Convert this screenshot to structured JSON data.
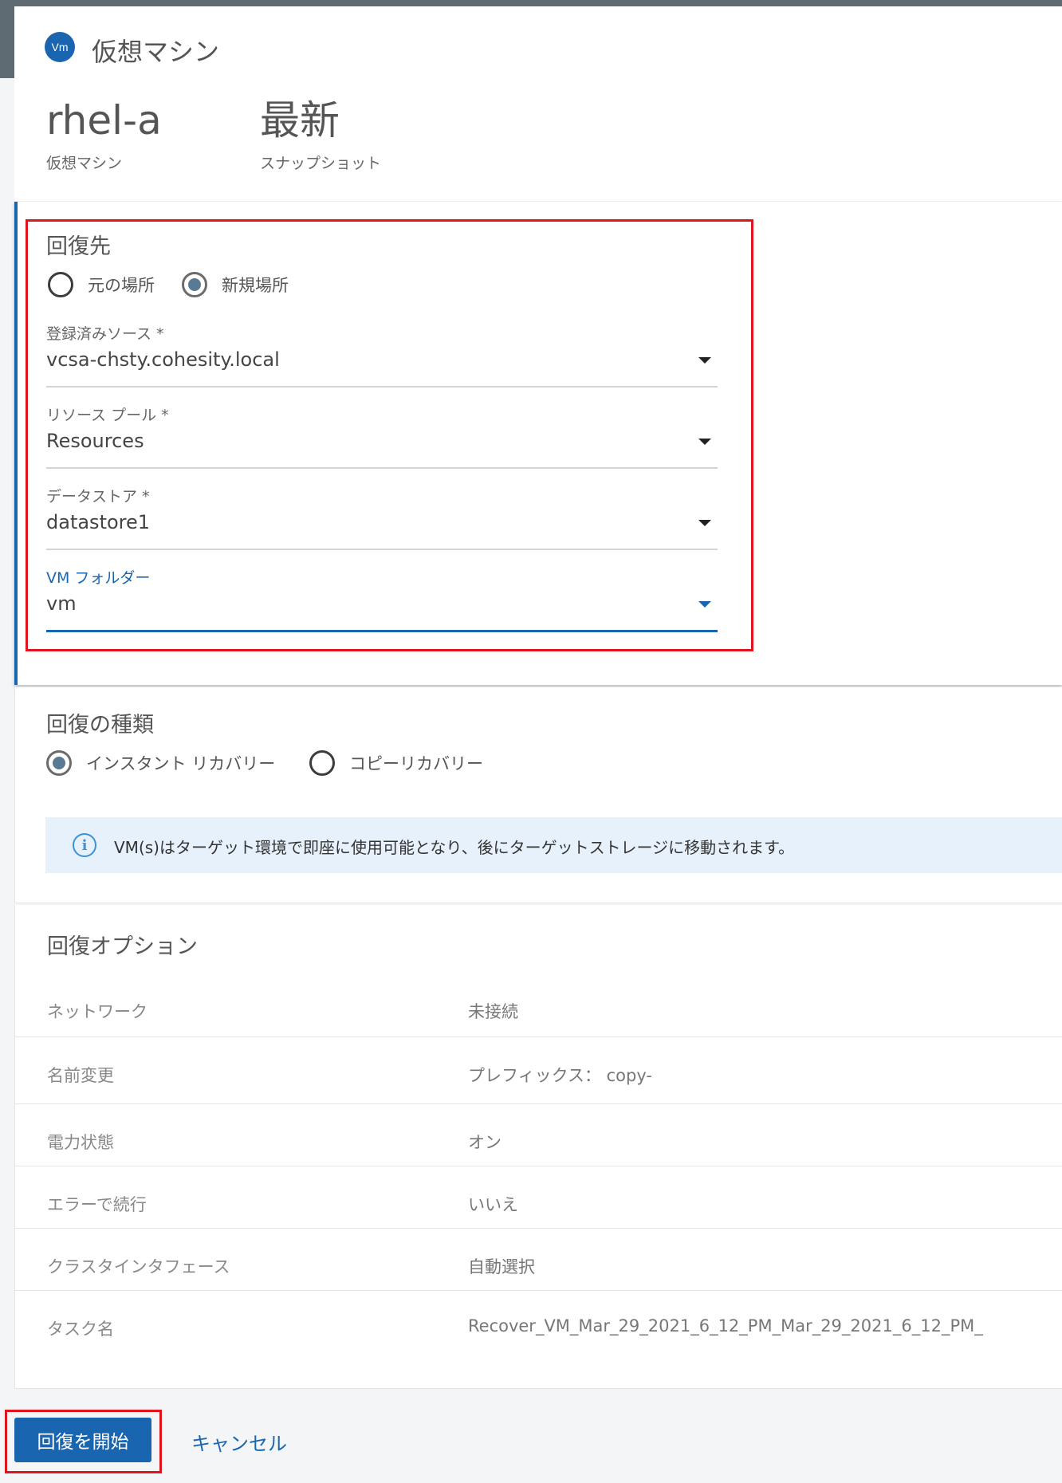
{
  "header": {
    "badge": "Vm",
    "title": "仮想マシン",
    "vm_name": "rhel-a",
    "vm_caption": "仮想マシン",
    "snapshot": "最新",
    "snapshot_caption": "スナップショット"
  },
  "target": {
    "title": "回復先",
    "radio_original": "元の場所",
    "radio_new": "新規場所",
    "selected": "新規場所",
    "fields": [
      {
        "label": "登録済みソース *",
        "value": "vcsa-chsty.cohesity.local"
      },
      {
        "label": "リソース プール *",
        "value": "Resources"
      },
      {
        "label": "データストア *",
        "value": "datastore1"
      },
      {
        "label": "VM フォルダー",
        "value": "vm"
      }
    ]
  },
  "recovery_type": {
    "title": "回復の種類",
    "option_instant": "インスタント リカバリー",
    "option_copy": "コピーリカバリー",
    "selected": "インスタント リカバリー",
    "info": "VM(s)はターゲット環境で即座に使用可能となり、後にターゲットストレージに移動されます。"
  },
  "options": {
    "title": "回復オプション",
    "rows": [
      {
        "key": "ネットワーク",
        "value": "未接続"
      },
      {
        "key": "名前変更",
        "value": "プレフィックス： copy-"
      },
      {
        "key": "電力状態",
        "value": "オン"
      },
      {
        "key": "エラーで続行",
        "value": "いいえ"
      },
      {
        "key": "クラスタインタフェース",
        "value": "自動選択"
      },
      {
        "key": "タスク名",
        "value": "Recover_VM_Mar_29_2021_6_12_PM_Mar_29_2021_6_12_PM_"
      }
    ]
  },
  "actions": {
    "start": "回復を開始",
    "cancel": "キャンセル"
  },
  "colors": {
    "accent": "#1a65b0",
    "highlight": "#e0141d",
    "info_bg": "#e7f1fb"
  }
}
